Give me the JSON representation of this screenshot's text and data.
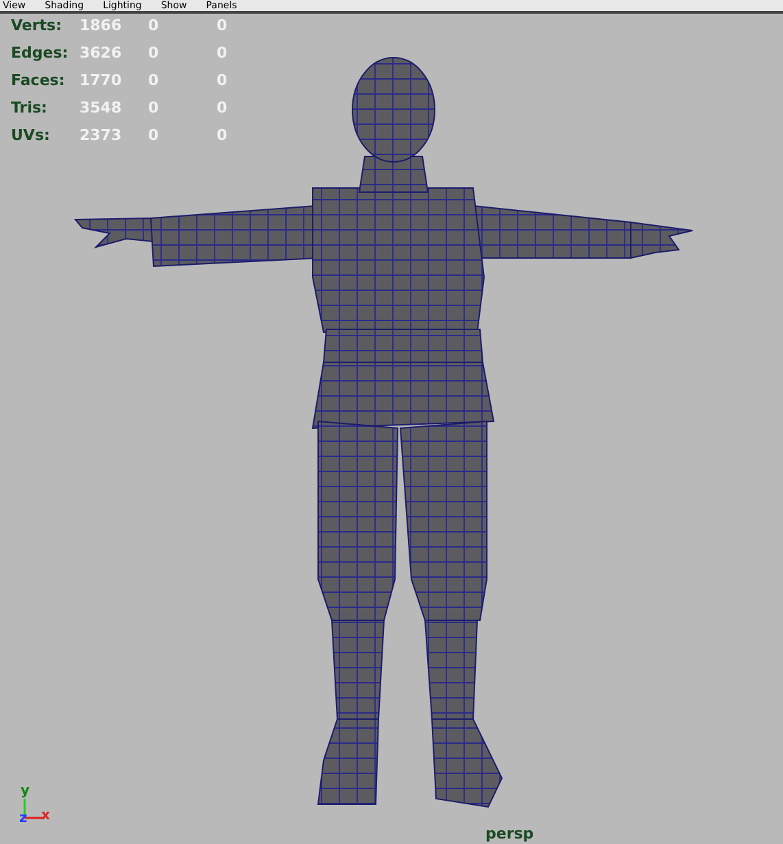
{
  "menu": [
    "View",
    "Shading",
    "Lighting",
    "Show",
    "Panels"
  ],
  "heads_up_display": [
    {
      "label": "Verts:",
      "values": [
        "1866",
        "0",
        "0"
      ]
    },
    {
      "label": "Edges:",
      "values": [
        "3626",
        "0",
        "0"
      ]
    },
    {
      "label": "Faces:",
      "values": [
        "1770",
        "0",
        "0"
      ]
    },
    {
      "label": "Tris:",
      "values": [
        "3548",
        "0",
        "0"
      ]
    },
    {
      "label": "UVs:",
      "values": [
        "2373",
        "0",
        "0"
      ]
    }
  ],
  "axis_labels": {
    "y": "y",
    "z": "z",
    "x": "x"
  },
  "camera": "persp"
}
